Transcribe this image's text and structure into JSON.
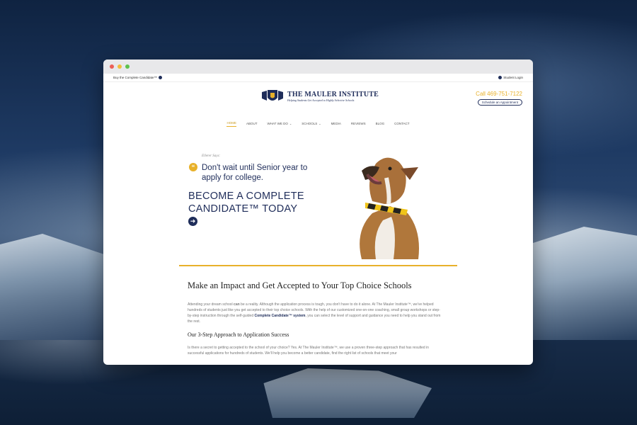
{
  "browser": {
    "title": ""
  },
  "topbar": {
    "left_link": "Buy the Complete Candidate™",
    "right_link": "Student Login"
  },
  "logo": {
    "name": "THE MAULER INSTITUTE",
    "tagline": "Helping Students Get Accepted to Highly Selective Schools"
  },
  "header": {
    "phone": "Call 469-751-7122",
    "appointment_button": "Schedule an Appointment"
  },
  "nav": {
    "items": [
      {
        "label": "HOME",
        "active": true
      },
      {
        "label": "ABOUT"
      },
      {
        "label": "WHAT WE DO",
        "dropdown": true
      },
      {
        "label": "SCHOOLS",
        "dropdown": true
      },
      {
        "label": "MEDIA"
      },
      {
        "label": "REVIEWS"
      },
      {
        "label": "BLOG"
      },
      {
        "label": "CONTACT"
      }
    ]
  },
  "hero": {
    "quote_by": "Ellerer Says:",
    "quote": "Don't wait until Senior year to apply for college.",
    "cta": "BECOME A COMPLETE CANDIDATE™ TODAY"
  },
  "content": {
    "heading": "Make an Impact and Get Accepted to Your Top Choice Schools",
    "para1_a": "Attending your dream school ",
    "para1_b": "can",
    "para1_c": " be a reality. Although the application process is tough, you don't have to do it alone. At The Mauler Institute™, we've helped hundreds of students just like you get accepted to their top choice schools. With the help of our customized one-on-one coaching, small group workshops or step-by-step instruction through the self-guided ",
    "para1_link": "Complete Candidate™ system",
    "para1_d": ", you can select the level of support and guidance you need to help you stand out from the rest.",
    "subheading": "Our 3-Step Approach to Application Success",
    "para2_a": "Is there a secret to getting accepted to the school of your choice? Yes. At The Mauler Institute™, we use a proven ",
    "para2_link": "three-step approach",
    "para2_b": " that has resulted in successful applications for hundreds of students. We'll help you become a better candidate, find the right list of schools that meet your"
  },
  "colors": {
    "navy": "#1f2d5a",
    "gold": "#e8b12a"
  }
}
